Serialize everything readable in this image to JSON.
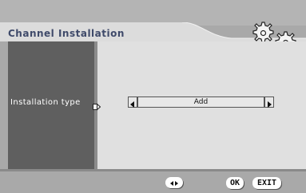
{
  "header": {
    "title": "Channel Installation"
  },
  "settings": {
    "installation_type": {
      "label": "Installation type",
      "value": "Add"
    }
  },
  "footer": {
    "nav_icon": "left-right-arrows-icon",
    "ok_label": "OK",
    "exit_label": "EXIT"
  },
  "colors": {
    "title_text": "#3f4a6a",
    "left_panel": "#5f5f5f",
    "main_panel": "#e0e0e0",
    "background": "#a9a9a9"
  }
}
